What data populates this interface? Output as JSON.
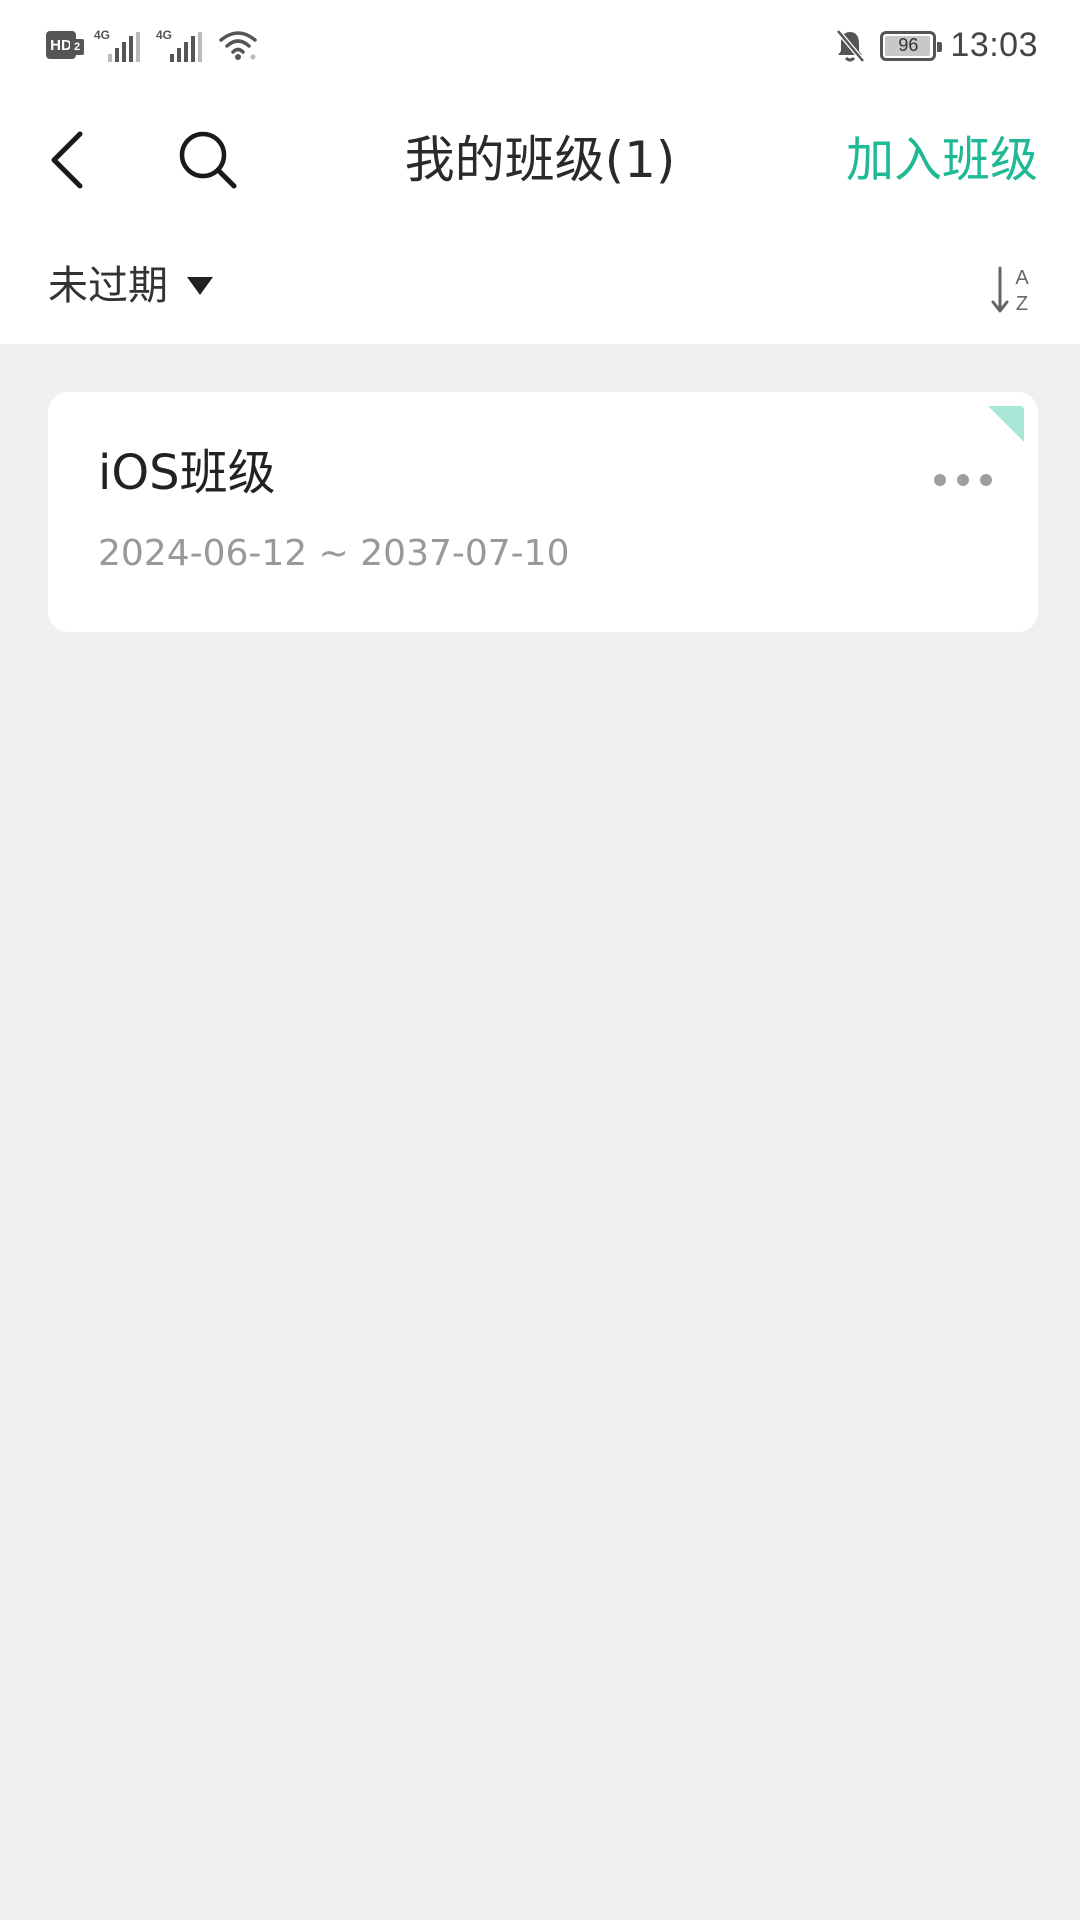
{
  "status_bar": {
    "hd_label": "HD",
    "hd_sub": "2",
    "sim1_gen": "4G",
    "sim2_gen": "4G",
    "battery_level": "96",
    "time": "13:03"
  },
  "header": {
    "title": "我的班级(1)",
    "join_label": "加入班级"
  },
  "filter": {
    "selected": "未过期"
  },
  "classes": [
    {
      "name": "iOS班级",
      "dates": "2024-06-12 ~ 2037-07-10"
    }
  ],
  "colors": {
    "accent": "#1fba95",
    "corner_tag": "#a8e6d6",
    "background": "#f0f0f0"
  },
  "icons": {
    "back": "chevron-left-icon",
    "search": "search-icon",
    "dropdown": "triangle-down-icon",
    "sort": "sort-az-icon",
    "more": "more-horizontal-icon"
  }
}
